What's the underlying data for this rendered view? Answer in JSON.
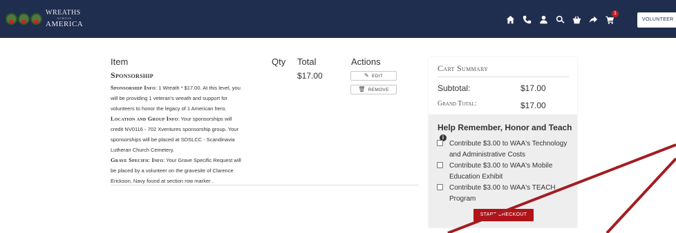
{
  "header": {
    "logo": {
      "line1": "WREATHS",
      "line2": "ACROSS",
      "line3": "AMERICA"
    },
    "nav_icons": [
      "home-icon",
      "phone-icon",
      "user-icon",
      "search-icon",
      "basket-icon",
      "share-icon",
      "cart-icon"
    ],
    "cart_count": "1",
    "volunteer_label": "VOLUNTEER",
    "background_color": "#1f2d4f"
  },
  "cart": {
    "columns": {
      "item": "Item",
      "qty": "Qty",
      "total": "Total",
      "actions": "Actions"
    },
    "item": {
      "name": "Sponsorship",
      "total": "$17.00",
      "edit_label": "EDIT",
      "remove_label": "REMOVE",
      "details": [
        {
          "label": "Sponsorship Info",
          "text": ": 1 Wreath * $17.00. At this level, you will be providing 1 veteran's wreath and support for volunteers to honor the legacy of 1 American hero."
        },
        {
          "label": "Location and Group Info",
          "text": ": Your sponsorships will credit NV0116 - 702 Xventures sponsorship group. Your sponsorships will be placed at SDSLCC - Scandinavia Lutheran Church Cemetery."
        },
        {
          "label": "Grave Specific Info",
          "text": ": Your Grave Specific Request will be placed by a volunteer on the gravesite of Clarence Erickson, Navy found at section row marker ."
        }
      ]
    }
  },
  "summary": {
    "title": "Cart Summary",
    "subtotal_label": "Subtotal:",
    "subtotal_value": "$17.00",
    "grand_total_label": "Grand Total:",
    "grand_total_value": "$17.00",
    "help_title": "Help Remember, Honor and Teach",
    "options": [
      "Contribute $3.00 to WAA's Technology and Administrative Costs",
      "Contribute $3.00 to WAA's Mobile Education Exhibit",
      "Contribute $3.00 to WAA's TEACH Program"
    ],
    "checkout_label": "START CHECKOUT",
    "accent_color": "#b11218"
  }
}
